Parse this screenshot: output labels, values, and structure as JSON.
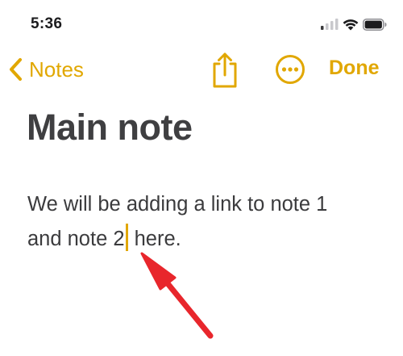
{
  "status_bar": {
    "time": "5:36",
    "icons": [
      "cellular-signal-icon",
      "wifi-icon",
      "battery-icon"
    ]
  },
  "nav": {
    "back_label": "Notes",
    "done_label": "Done",
    "icons": [
      "chevron-left-icon",
      "share-icon",
      "more-options-icon"
    ],
    "accent_color": "#e1a700"
  },
  "note": {
    "title": "Main note",
    "body_line1": "We will be adding a link to note 1",
    "body_line2_before_cursor": "and note 2",
    "body_line2_after_cursor": " here."
  },
  "annotation": {
    "arrow_color": "#e8262c",
    "arrow_icon": "red-annotation-arrow"
  }
}
